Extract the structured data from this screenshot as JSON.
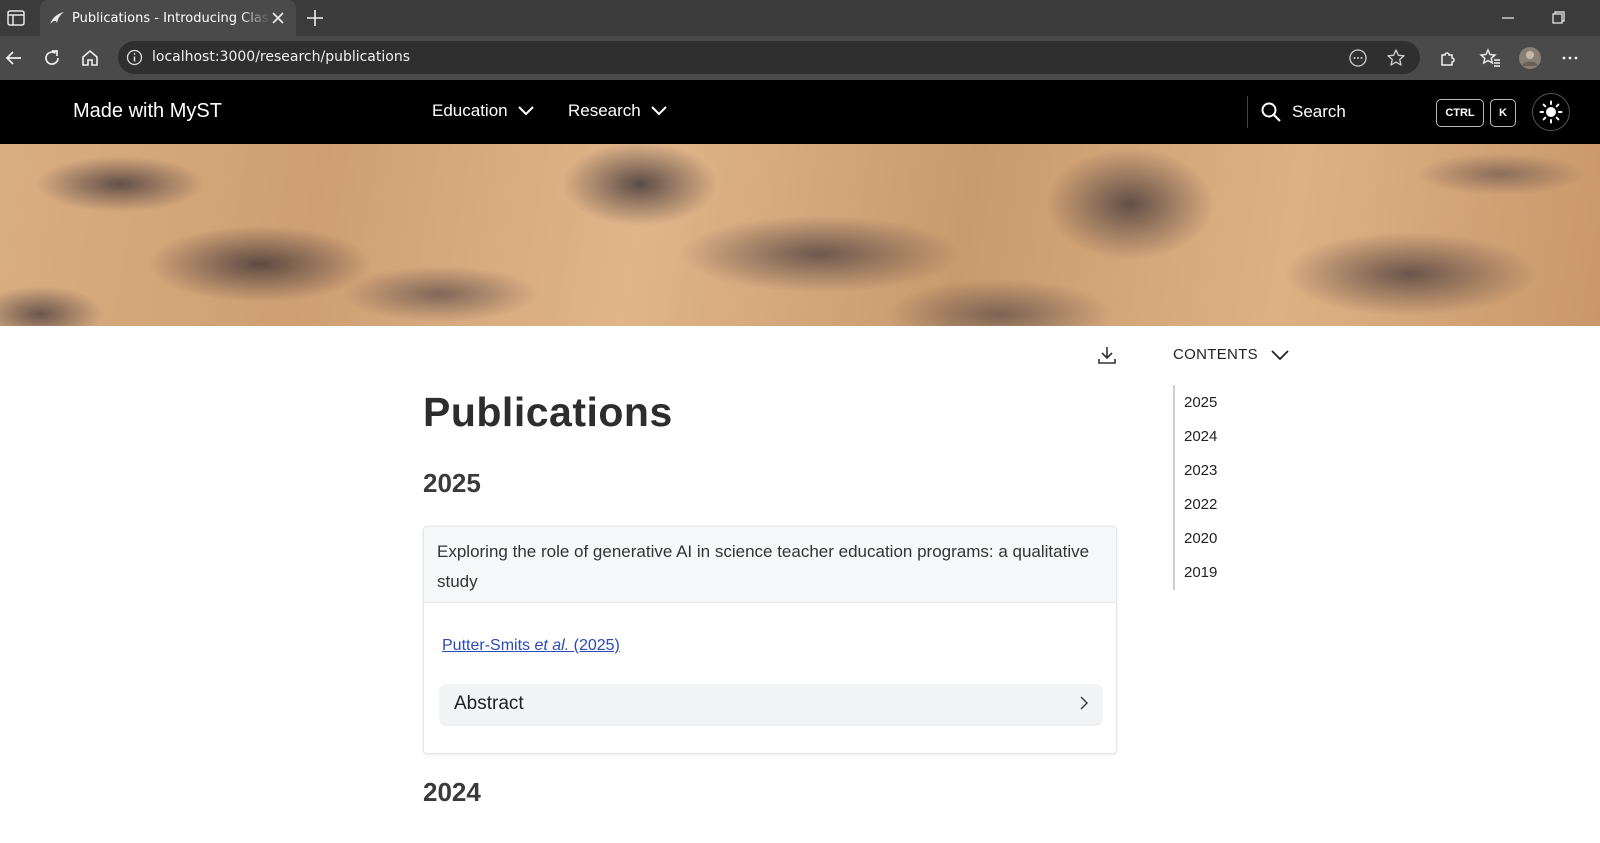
{
  "browser": {
    "tab_title": "Publications - Introducing Classic",
    "url": "localhost:3000/research/publications"
  },
  "site": {
    "brand": "Made with MyST",
    "nav": [
      {
        "label": "Education"
      },
      {
        "label": "Research"
      }
    ],
    "search": {
      "label": "Search",
      "shortcut_mod": "CTRL",
      "shortcut_key": "K"
    }
  },
  "article": {
    "title": "Publications",
    "sections": [
      {
        "year": "2025",
        "publications": [
          {
            "title": "Exploring the role of generative AI in science teacher education programs: a qualitative study",
            "cite_author": "Putter-Smits",
            "cite_etal": "et al.",
            "cite_year": "(2025)",
            "abstract_label": "Abstract"
          }
        ]
      },
      {
        "year": "2024"
      }
    ]
  },
  "toc": {
    "header": "CONTENTS",
    "items": [
      "2025",
      "2024",
      "2023",
      "2022",
      "2020",
      "2019"
    ]
  },
  "colors": {
    "header_bg": "#000000",
    "link": "#2a4bb4",
    "title": "#2d2d2d"
  }
}
